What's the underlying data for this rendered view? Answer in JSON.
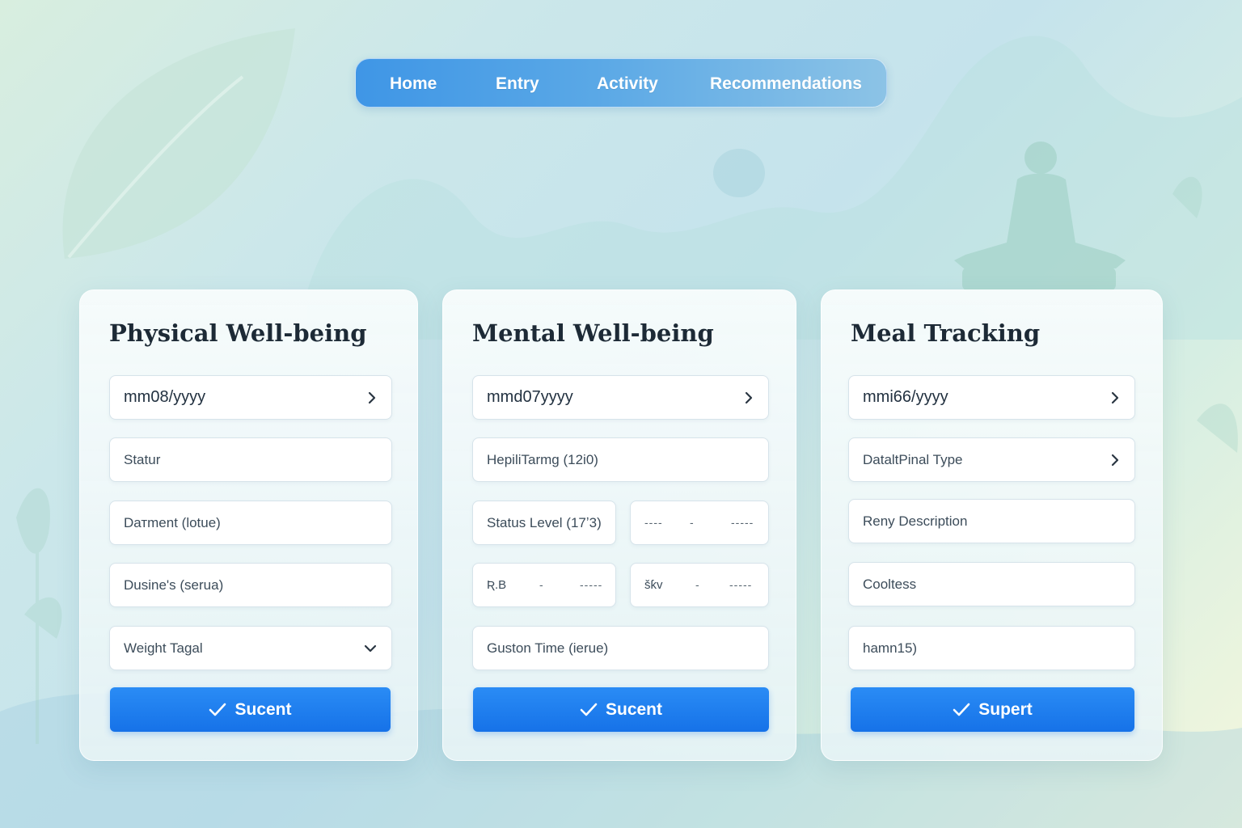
{
  "nav": {
    "items": [
      {
        "label": "Home"
      },
      {
        "label": "Entry"
      },
      {
        "label": "Activity"
      },
      {
        "label": "Recommendations"
      }
    ]
  },
  "physical": {
    "title": "Physical Well-being",
    "date_field": "mm08/yyyy",
    "field_1": "Statur",
    "field_2": "Dатment (lotue)",
    "field_3": "Dusine's (serua)",
    "select": "Weight Tagal",
    "submit_label": "Sucent"
  },
  "mental": {
    "title": "Mental Well-being",
    "date_field": "mmd07yyyy",
    "field_1": "HepiliTarmg (12i0)",
    "field_2": "Status Level (17ʼ3)",
    "field_2b_left": "----",
    "field_2b_mid": "-",
    "field_2b_right": "-----",
    "field_3a_label": "Ʀ.B",
    "field_3a_mid": "-",
    "field_3a_right": "-----",
    "field_3b_label": "šƙᴠ",
    "field_3b_mid": "-",
    "field_3b_right": "-----",
    "field_4": "Guston Time (ierue)",
    "submit_label": "Sucent"
  },
  "meal": {
    "title": "Meal Tracking",
    "date_field": "mmi66/yyyy",
    "field_1": "DataltPinal Type",
    "field_2": "Reny Description",
    "field_3": "Cooltess",
    "field_4": "hamn15)",
    "submit_label": "Supert"
  },
  "icons": {
    "chevron_right": "chevron-right-icon",
    "chevron_down": "chevron-down-icon",
    "check": "check-icon"
  },
  "colors": {
    "nav_start": "#3f96e6",
    "nav_end": "#8cc3e6",
    "button": "#1f80ee",
    "title_text": "#1d2a36"
  }
}
